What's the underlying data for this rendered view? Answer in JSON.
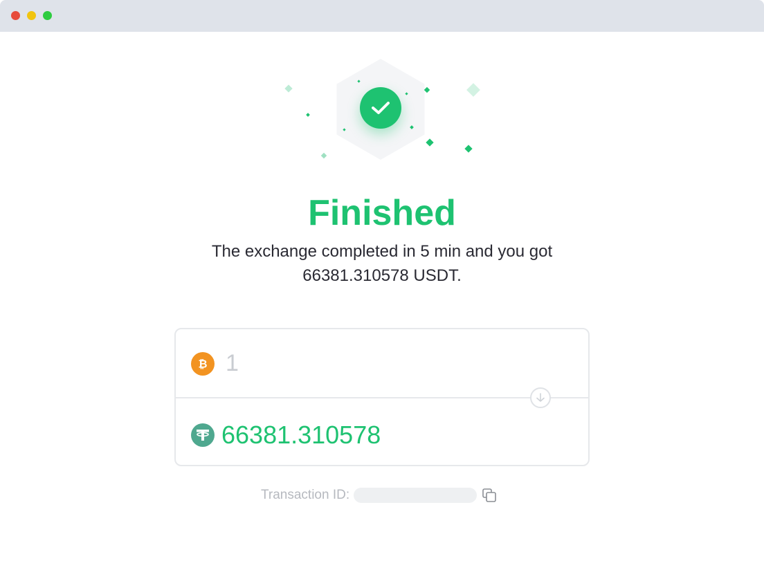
{
  "window": {
    "controls": [
      "close",
      "minimize",
      "maximize"
    ]
  },
  "hero": {
    "icon": "check-icon",
    "accent_color": "#1ec271"
  },
  "status": {
    "title": "Finished",
    "message": "The exchange completed in 5 min and you got 66381.310578 USDT."
  },
  "exchange": {
    "from": {
      "icon": "bitcoin-icon",
      "amount": "1"
    },
    "to": {
      "icon": "tether-icon",
      "amount": "66381.310578"
    },
    "swap_icon": "arrow-down-icon"
  },
  "transaction": {
    "label": "Transaction ID:",
    "value": "",
    "copy_icon": "copy-icon"
  }
}
